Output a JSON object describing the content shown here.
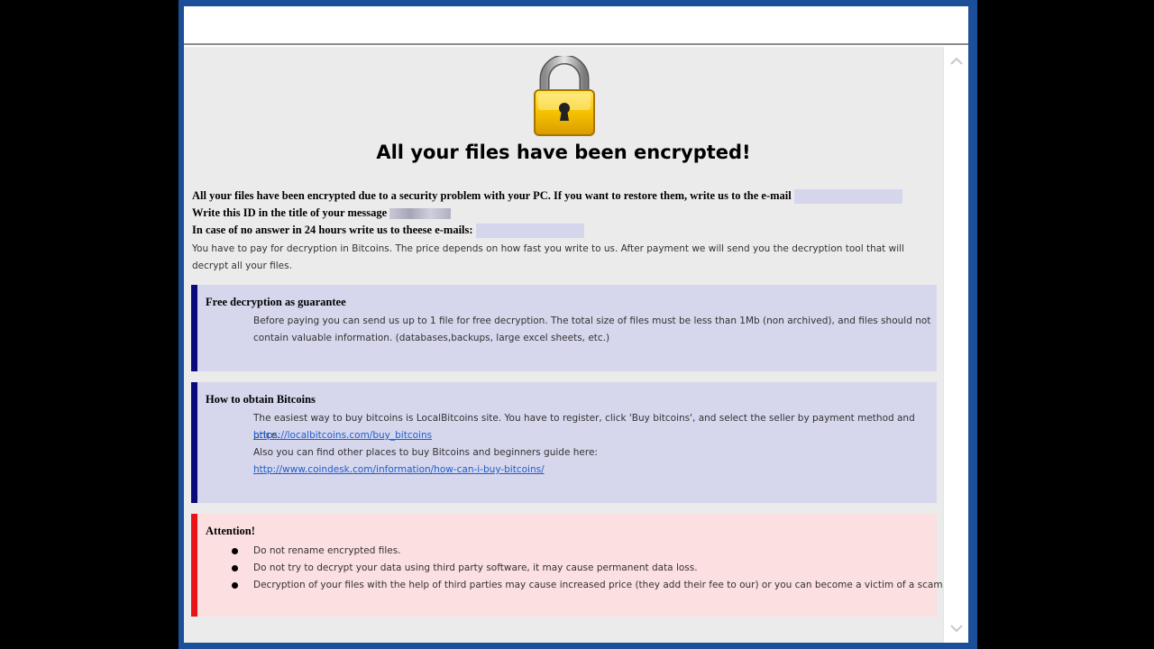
{
  "header": {
    "title": "All your files have been encrypted!"
  },
  "intro": {
    "line1": "All your files have been encrypted due to a security problem with your PC. If you want to restore them, write us to the e-mail",
    "line2": "Write this ID in the title of your message",
    "line3": "In case of no answer in 24 hours write us to theese e-mails:",
    "payment": "You have to pay for decryption in Bitcoins. The price depends on how fast you write to us. After payment we will send you the decryption tool that will decrypt all your files."
  },
  "guarantee": {
    "title": "Free decryption as guarantee",
    "text": "Before paying you can send us up to 1 file for free decryption. The total size of files must be less than 1Mb (non archived), and files should not contain valuable information. (databases,backups, large excel sheets, etc.)"
  },
  "bitcoins": {
    "title": "How to obtain Bitcoins",
    "text1": "The easiest way to buy bitcoins is LocalBitcoins site. You have to register, click 'Buy bitcoins', and select the seller by payment method and price.",
    "link1": "https://localbitcoins.com/buy_bitcoins",
    "text2": "Also you can find other places to buy Bitcoins and beginners guide here:",
    "link2": "http://www.coindesk.com/information/how-can-i-buy-bitcoins/"
  },
  "attention": {
    "title": "Attention!",
    "items": [
      "Do not rename encrypted files.",
      "Do not try to decrypt your data using third party software, it may cause permanent data loss.",
      "Decryption of your files with the help of third parties may cause increased price (they add their fee to our) or you can become a victim of a scam."
    ]
  },
  "colors": {
    "window_border": "#1c4f9a",
    "info_box": "#d6d6ec",
    "info_bar": "#0a0a7a",
    "attention_box": "#fcdfe0",
    "attention_bar": "#e8141a",
    "link": "#1a5fd0"
  },
  "icons": {
    "lock": "padlock-icon",
    "scroll_up": "chevron-up-icon",
    "scroll_down": "chevron-down-icon"
  }
}
